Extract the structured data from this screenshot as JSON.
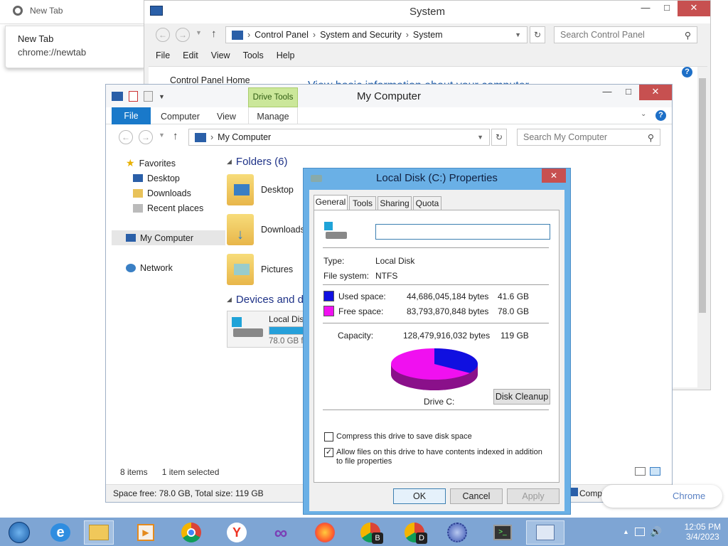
{
  "chrome": {
    "tab_label": "New Tab",
    "popup_title": "New Tab",
    "popup_url": "chrome://newtab",
    "bubble_text": "Chrome"
  },
  "system_window": {
    "title": "System",
    "breadcrumb": [
      "Control Panel",
      "System and Security",
      "System"
    ],
    "search_placeholder": "Search Control Panel",
    "menu": [
      "File",
      "Edit",
      "View",
      "Tools",
      "Help"
    ],
    "sidebar_link": "Control Panel Home",
    "heading": "View basic information about your computer"
  },
  "explorer": {
    "title": "My Computer",
    "context_tab": "Drive Tools",
    "ribbon_tabs": [
      "File",
      "Computer",
      "View",
      "Manage"
    ],
    "address": "My Computer",
    "search_placeholder": "Search My Computer",
    "nav": {
      "favorites": "Favorites",
      "favorites_items": [
        "Desktop",
        "Downloads",
        "Recent places"
      ],
      "computer": "My Computer",
      "network": "Network"
    },
    "folders_header": "Folders (6)",
    "folders": [
      "Desktop",
      "Downloads",
      "Pictures"
    ],
    "devices_header": "Devices and drives",
    "drive_label": "Local Disk (C:)",
    "drive_free": "78.0 GB free of 119 GB",
    "drive_used_fraction": 0.65,
    "status_items": "8 items",
    "status_selected": "1 item selected",
    "footer_left": "Space free: 78.0 GB, Total size: 119 GB",
    "footer_right": "Computer"
  },
  "properties": {
    "title": "Local Disk (C:) Properties",
    "tabs": [
      "General",
      "Tools",
      "Sharing",
      "Quota"
    ],
    "name_value": "",
    "type_label": "Type:",
    "type_value": "Local Disk",
    "fs_label": "File system:",
    "fs_value": "NTFS",
    "used_label": "Used space:",
    "used_bytes": "44,686,045,184 bytes",
    "used_gb": "41.6 GB",
    "free_label": "Free space:",
    "free_bytes": "83,793,870,848 bytes",
    "free_gb": "78.0 GB",
    "capacity_label": "Capacity:",
    "capacity_bytes": "128,479,916,032 bytes",
    "capacity_gb": "119 GB",
    "drive_caption": "Drive C:",
    "cleanup_button": "Disk Cleanup",
    "compress_label": "Compress this drive to save disk space",
    "compress_checked": false,
    "index_label": "Allow files on this drive to have contents indexed in addition to file properties",
    "index_checked": true,
    "ok": "OK",
    "cancel": "Cancel",
    "apply": "Apply",
    "used_color": "#1010e0",
    "free_color": "#f010f0",
    "used_fraction": 0.348
  },
  "taskbar": {
    "apps": [
      "start-button",
      "internet-explorer-icon",
      "file-explorer-icon",
      "media-player-icon",
      "chrome-icon",
      "yandex-icon",
      "visual-studio-icon",
      "firefox-icon",
      "chrome-beta-icon",
      "chrome-dev-icon",
      "settings-gear-icon",
      "terminal-icon",
      "control-panel-icon"
    ],
    "time": "12:05 PM",
    "date": "3/4/2023"
  }
}
